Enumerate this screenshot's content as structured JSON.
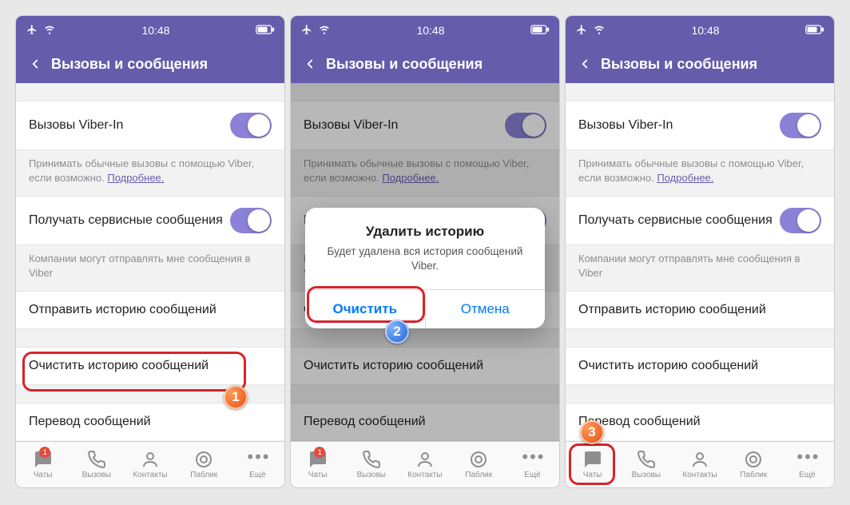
{
  "statusbar": {
    "time": "10:48"
  },
  "header": {
    "title": "Вызовы и сообщения"
  },
  "settings": {
    "viber_in_label": "Вызовы Viber-In",
    "viber_in_desc_pre": "Принимать обычные вызовы с помощью Viber, если возможно. ",
    "viber_in_more": "Подробнее.",
    "service_msgs_label": "Получать сервисные сообщения",
    "service_msgs_desc": "Компании могут отправлять мне сообщения в Viber",
    "send_history": "Отправить историю сообщений",
    "clear_history": "Очистить историю сообщений",
    "translate": "Перевод сообщений"
  },
  "alert": {
    "title": "Удалить историю",
    "message": "Будет удалена вся история сообщений Viber.",
    "clear": "Очистить",
    "cancel": "Отмена"
  },
  "tabs": {
    "chats": "Чаты",
    "calls": "Вызовы",
    "contacts": "Контакты",
    "public": "Паблик",
    "more": "Ещё",
    "chats_badge": "1"
  },
  "annotations": {
    "n1": "1",
    "n2": "2",
    "n3": "3"
  }
}
